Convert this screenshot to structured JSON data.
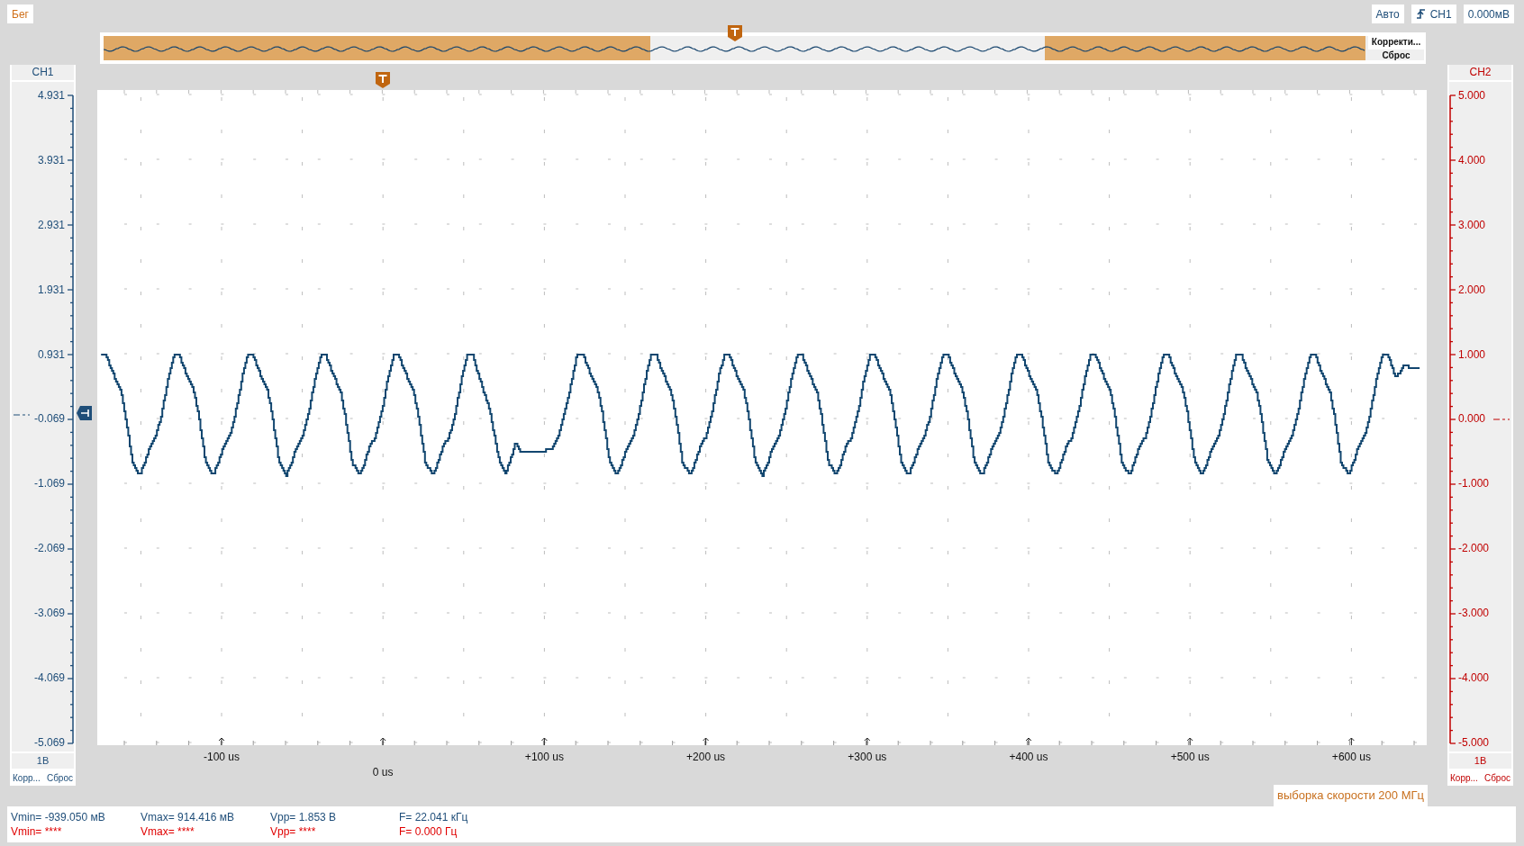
{
  "toolbar": {
    "run_button": "Бег",
    "mode_button": "Авто",
    "trigger_source": "CH1",
    "trigger_level": "0.000мВ"
  },
  "overview": {
    "buttons": [
      "Корректи...",
      "Сброс"
    ]
  },
  "channels": [
    {
      "name": "CH1",
      "color": "#1f4e79",
      "axis_labels": [
        "4.931",
        "3.931",
        "2.931",
        "1.931",
        "0.931",
        "-0.069",
        "-1.069",
        "-2.069",
        "-3.069",
        "-4.069",
        "-5.069"
      ],
      "scale": "1В",
      "buttons": [
        "Корр...",
        "Сброс"
      ]
    },
    {
      "name": "CH2",
      "color": "#c00000",
      "axis_labels": [
        "5.000",
        "4.000",
        "3.000",
        "2.000",
        "1.000",
        "0.000",
        "-1.000",
        "-2.000",
        "-3.000",
        "-4.000",
        "-5.000"
      ],
      "scale": "1В",
      "buttons": [
        "Корр...",
        "Сброс"
      ]
    }
  ],
  "time_axis": {
    "labels": [
      {
        "text": "-100 us",
        "kind": "major"
      },
      {
        "text": "0 us",
        "kind": "trigger"
      },
      {
        "text": "+100 us",
        "kind": "major"
      },
      {
        "text": "+200 us",
        "kind": "major"
      },
      {
        "text": "+300 us",
        "kind": "major"
      },
      {
        "text": "+400 us",
        "kind": "major"
      },
      {
        "text": "+500 us",
        "kind": "major"
      },
      {
        "text": "+600 us",
        "kind": "major"
      }
    ]
  },
  "sample_rate": "выборка скорости 200 МГц",
  "measurements": [
    {
      "color": "#1f4e79",
      "values": [
        "Vmin= -939.050 мВ",
        "Vmax= 914.416 мВ",
        "Vpp= 1.853 В",
        "F= 22.041 кГц"
      ]
    },
    {
      "color": "#e00000",
      "values": [
        "Vmin= ****",
        "Vmax= ****",
        "Vpp= ****",
        "F= 0.000 Гц"
      ]
    }
  ]
}
